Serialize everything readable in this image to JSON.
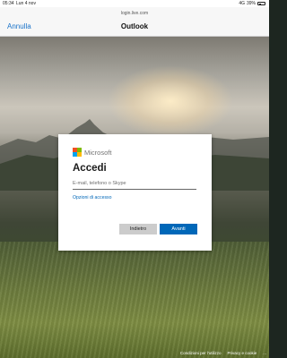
{
  "status_bar": {
    "time": "05:34",
    "date": "Lun 4 nov",
    "network": "4G",
    "battery_text": "39%",
    "battery_level": 0.39
  },
  "browser": {
    "url": "login.live.com",
    "cancel_label": "Annulla",
    "title": "Outlook"
  },
  "card": {
    "brand": "Microsoft",
    "heading": "Accedi",
    "email_placeholder": "E-mail, telefono o Skype",
    "email_value": "",
    "options_link": "Opzioni di accesso",
    "back_label": "Indietro",
    "next_label": "Avanti",
    "logo_colors": [
      "#f25022",
      "#7fba00",
      "#00a4ef",
      "#ffb900"
    ]
  },
  "footer": {
    "terms": "Condizioni per l'utilizzo",
    "privacy": "Privacy e cookie",
    "more": "..."
  }
}
